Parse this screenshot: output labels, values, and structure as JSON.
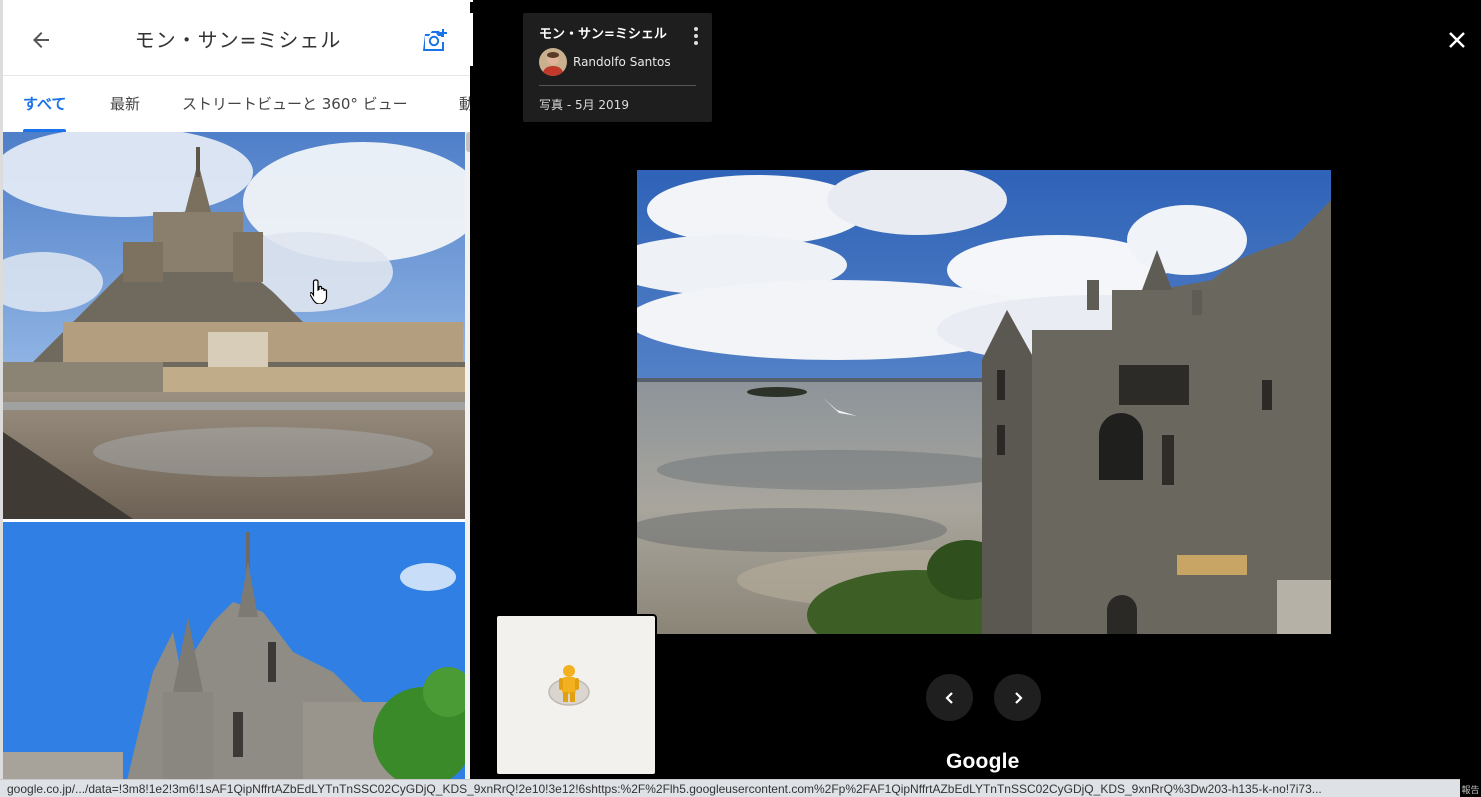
{
  "panel": {
    "title": "モン・サン=ミシェル",
    "back_icon": "arrow-left-icon",
    "add_photo_icon": "camera-add-icon",
    "accent_color": "#1a73e8"
  },
  "tabs": [
    {
      "label": "すべて",
      "active": true
    },
    {
      "label": "最新",
      "active": false
    },
    {
      "label": "ストリートビューと 360° ビュー",
      "active": false
    },
    {
      "label": "動",
      "active": false
    }
  ],
  "viewer": {
    "info_card": {
      "title": "モン・サン=ミシェル",
      "author": "Randolfo Santos",
      "date": "写真 - 5月 2019"
    },
    "close_icon": "close-icon",
    "prev_icon": "chevron-left-icon",
    "next_icon": "chevron-right-icon",
    "logo": "Google",
    "pegman_icon": "pegman-icon"
  },
  "status_bar": {
    "url": "google.co.jp/.../data=!3m8!1e2!3m6!1sAF1QipNffrtAZbEdLYTnTnSSC02CyGDjQ_KDS_9xnRrQ!2e10!3e12!6shttps:%2F%2Flh5.googleusercontent.com%2Fp%2FAF1QipNffrtAZbEdLYTnTnSSC02CyGDjQ_KDS_9xnRrQ%3Dw203-h135-k-no!7i73..."
  },
  "report_label": "報告"
}
